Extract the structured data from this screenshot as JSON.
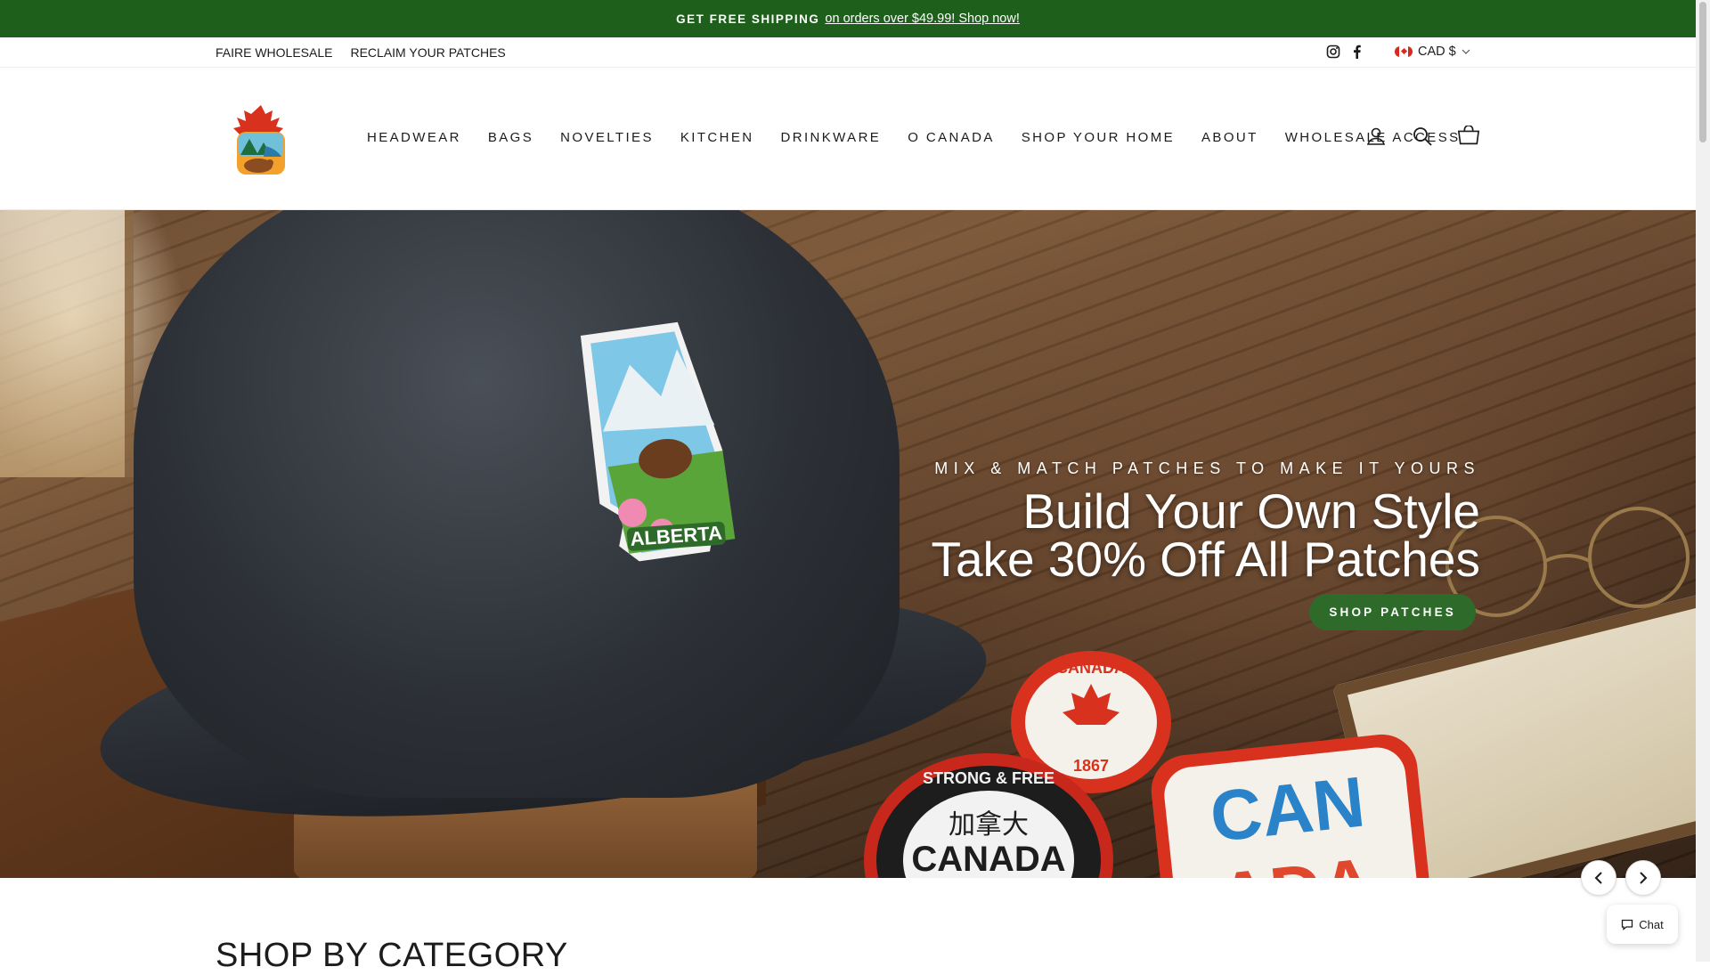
{
  "announcement": {
    "bold": "GET FREE SHIPPING",
    "link": "on orders over $49.99! Shop now!"
  },
  "utility": {
    "links": [
      "FAIRE WHOLESALE",
      "RECLAIM YOUR PATCHES"
    ],
    "social": [
      "instagram-icon",
      "facebook-icon"
    ],
    "currency": "CAD $"
  },
  "nav": {
    "items": [
      "HEADWEAR",
      "BAGS",
      "NOVELTIES",
      "KITCHEN",
      "DRINKWARE",
      "O CANADA",
      "SHOP YOUR HOME",
      "ABOUT",
      "WHOLESALE ACCESS"
    ],
    "icons": [
      "account-icon",
      "search-icon",
      "cart-icon"
    ]
  },
  "hero": {
    "kicker": "MIX & MATCH PATCHES TO MAKE IT YOURS",
    "headline_line1": "Build Your Own Style",
    "headline_line2": "Take 30% Off All Patches",
    "cta": "SHOP PATCHES",
    "patch_texts": [
      "ALBERTA",
      "CANADA",
      "1867",
      "STRONG & FREE",
      "加拿大",
      "CANADA",
      "CAN",
      "ADA"
    ]
  },
  "section": {
    "title": "SHOP BY CATEGORY"
  },
  "chat": {
    "label": "Chat"
  },
  "colors": {
    "brand_green": "#1f5f1c",
    "cta_green": "#2e6b2a"
  }
}
